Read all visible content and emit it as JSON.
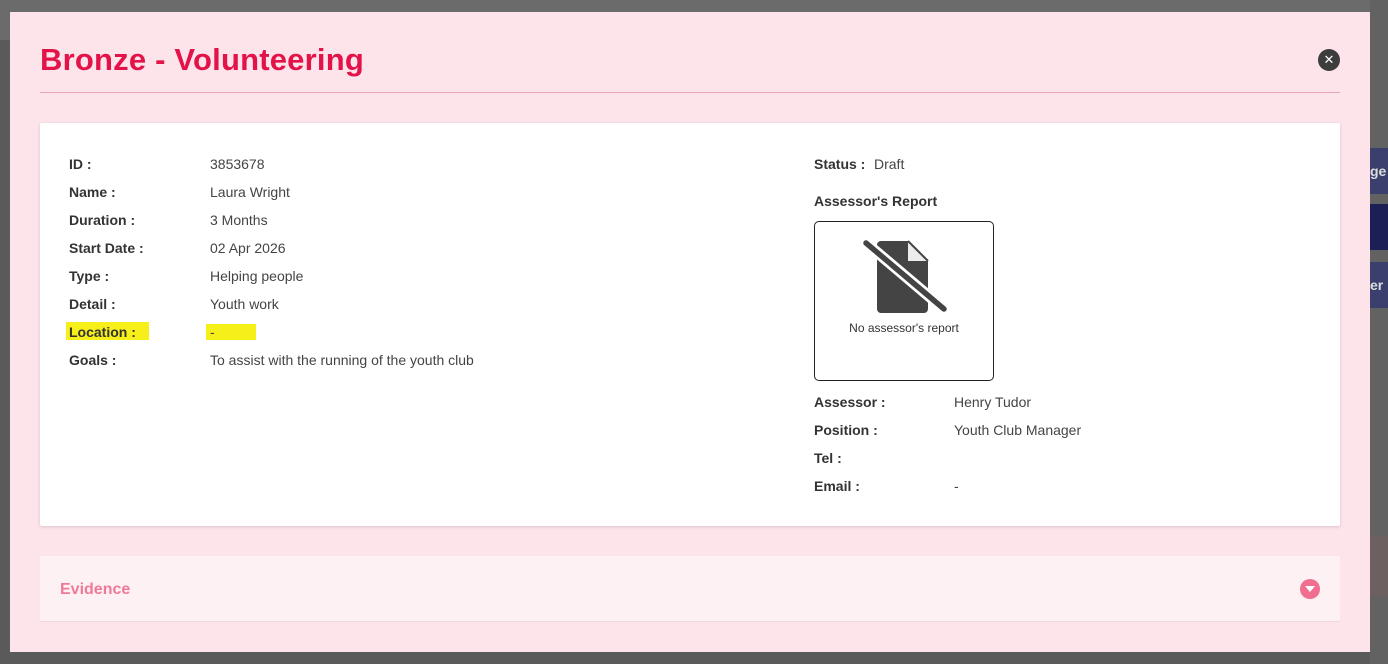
{
  "modal": {
    "title": "Bronze - Volunteering",
    "close_icon": "close-icon"
  },
  "details": {
    "id_label": "ID :",
    "id_value": "3853678",
    "name_label": "Name :",
    "name_value": "Laura Wright",
    "duration_label": "Duration :",
    "duration_value": "3 Months",
    "start_date_label": "Start Date :",
    "start_date_value": "02 Apr 2026",
    "type_label": "Type :",
    "type_value": "Helping people",
    "detail_label": "Detail :",
    "detail_value": "Youth work",
    "location_label": "Location :",
    "location_value": "-",
    "goals_label": "Goals :",
    "goals_value": "To assist with the running of the youth club"
  },
  "status": {
    "label": "Status :",
    "value": "Draft"
  },
  "report": {
    "title": "Assessor's Report",
    "empty_text": "No assessor's report",
    "icon": "no-file-icon"
  },
  "assessor": {
    "assessor_label": "Assessor :",
    "assessor_value": "Henry Tudor",
    "position_label": "Position :",
    "position_value": "Youth Club Manager",
    "tel_label": "Tel :",
    "tel_value": "",
    "email_label": "Email :",
    "email_value": "-"
  },
  "evidence": {
    "title": "Evidence",
    "toggle_icon": "chevron-down-icon"
  },
  "background": {
    "right_text_1": "ge",
    "right_text_3": "er"
  },
  "colors": {
    "title": "#e3134a",
    "modal_bg": "#fde4ea",
    "highlight": "#f7ef1a",
    "evidence_accent": "#f06e90"
  }
}
